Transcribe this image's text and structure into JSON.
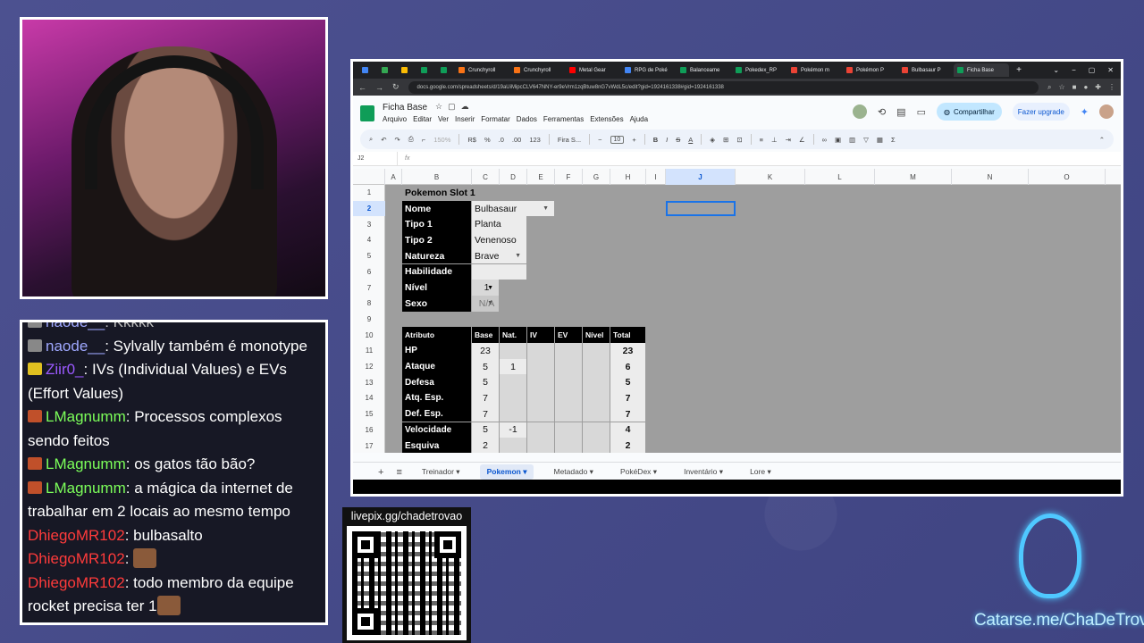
{
  "stream": {
    "qr_label": "livepix.gg/chadetrovao",
    "catarse": "Catarse.me/ChaDeTrovao"
  },
  "chat": [
    {
      "user": "naode__",
      "text": "Kkkkk",
      "color": "#9fa8ff"
    },
    {
      "user": "naode__",
      "text": "Sylvally também é monotype",
      "color": "#9fa8ff"
    },
    {
      "user": "Ziir0_",
      "text": "IVs (Individual Values) e EVs (Effort Values)",
      "color": "#9b59ff"
    },
    {
      "user": "LMagnumm",
      "text": "Processos complexos sendo feitos",
      "color": "#7cff5a"
    },
    {
      "user": "LMagnumm",
      "text": "os gatos tão bão?",
      "color": "#7cff5a"
    },
    {
      "user": "LMagnumm",
      "text": "a mágica da internet de trabalhar em 2 locais ao mesmo tempo",
      "color": "#7cff5a"
    },
    {
      "user": "DhiegoMR102",
      "text": "bulbasalto",
      "color": "#ff3b3b"
    },
    {
      "user": "DhiegoMR102",
      "text": "",
      "color": "#ff3b3b"
    },
    {
      "user": "DhiegoMR102",
      "text": "todo membro da equipe rocket precisa ter 1",
      "color": "#ff3b3b"
    }
  ],
  "browser": {
    "tabs": [
      "Crunchyroll",
      "Crunchyroll",
      "Metal Gear",
      "RPG de Poké",
      "Balanceame",
      "Pokedex_RP",
      "Pokémon m",
      "Pokémon P",
      "Bulbasaur P",
      "Ficha Base"
    ],
    "url": "docs.google.com/spreadsheets/d/19aUiMipcCLV647NNY-er9eVrm1zqBtuw8nG7vWdL5c/edit?gid=1924161338#gid=1924161338"
  },
  "sheets": {
    "title": "Ficha Base",
    "menu": [
      "Arquivo",
      "Editar",
      "Ver",
      "Inserir",
      "Formatar",
      "Dados",
      "Ferramentas",
      "Extensões",
      "Ajuda"
    ],
    "share": "Compartilhar",
    "upgrade": "Fazer upgrade",
    "toolbar": {
      "zoom": "150%",
      "currency": "R$",
      "percent": "%",
      "dec_less": ".0",
      "dec_more": ".00",
      "fmt": "123",
      "font": "Fira S...",
      "size": "10"
    },
    "namebox": "J2",
    "fx": "fx",
    "columns": [
      "A",
      "B",
      "C",
      "D",
      "E",
      "F",
      "G",
      "H",
      "I",
      "J",
      "K",
      "L",
      "M",
      "N",
      "O"
    ],
    "rows": [
      "1",
      "2",
      "3",
      "4",
      "5",
      "6",
      "7",
      "8",
      "9",
      "10",
      "11",
      "12",
      "13",
      "14",
      "15",
      "16",
      "17"
    ],
    "slot_title": "Pokemon Slot 1",
    "info": [
      {
        "label": "Nome",
        "value": "Bulbasaur"
      },
      {
        "label": "Tipo 1",
        "value": "Planta"
      },
      {
        "label": "Tipo 2",
        "value": "Venenoso"
      },
      {
        "label": "Natureza",
        "value": "Brave"
      },
      {
        "label": "Habilidade",
        "value": ""
      },
      {
        "label": "Nível",
        "value": "1"
      },
      {
        "label": "Sexo",
        "value": "N/A"
      }
    ],
    "stats_headers": [
      "Atributo",
      "Base",
      "Nat.",
      "IV",
      "EV",
      "Nível",
      "Total"
    ],
    "stats": [
      {
        "attr": "HP",
        "base": "23",
        "nat": "",
        "total": "23"
      },
      {
        "attr": "Ataque",
        "base": "5",
        "nat": "1",
        "total": "6"
      },
      {
        "attr": "Defesa",
        "base": "5",
        "nat": "",
        "total": "5"
      },
      {
        "attr": "Atq. Esp.",
        "base": "7",
        "nat": "",
        "total": "7"
      },
      {
        "attr": "Def. Esp.",
        "base": "7",
        "nat": "",
        "total": "7"
      },
      {
        "attr": "Velocidade",
        "base": "5",
        "nat": "-1",
        "total": "4"
      },
      {
        "attr": "Esquiva",
        "base": "2",
        "nat": "",
        "total": "2"
      }
    ],
    "sheet_tabs": [
      "Treinador",
      "Pokemon",
      "Metadado",
      "PokéDex",
      "Inventário",
      "Lore"
    ],
    "active_tab": "Pokemon"
  }
}
